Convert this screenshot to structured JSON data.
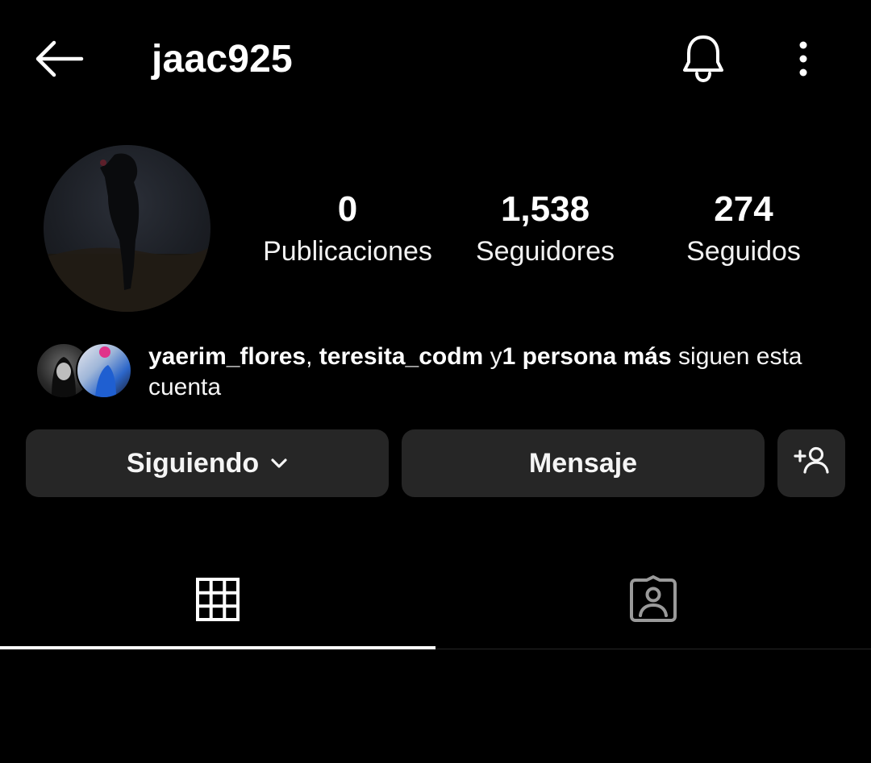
{
  "header": {
    "username": "jaac925",
    "back_icon": "arrow-left-icon",
    "bell_icon": "bell-icon",
    "more_icon": "more-vertical-icon"
  },
  "profile": {
    "stats": [
      {
        "value": "0",
        "label": "Publicaciones"
      },
      {
        "value": "1,538",
        "label": "Seguidores"
      },
      {
        "value": "274",
        "label": "Seguidos"
      }
    ],
    "followed_by": {
      "user1": "yaerim_flores",
      "separator": ", ",
      "user2": "teresita_codm",
      "conj": " y",
      "others": "1 persona más",
      "suffix": " siguen esta cuenta"
    }
  },
  "actions": {
    "following_label": "Siguiendo",
    "message_label": "Mensaje",
    "add_user_icon": "add-user-icon",
    "chevron_icon": "chevron-down-icon"
  },
  "tabs": [
    {
      "name": "posts-grid",
      "icon": "grid-icon",
      "active": true
    },
    {
      "name": "tagged",
      "icon": "tagged-person-icon",
      "active": false
    }
  ],
  "colors": {
    "background": "#000000",
    "button_bg": "#262626",
    "text": "#ffffff",
    "icon_inactive": "#9a9a9a"
  }
}
